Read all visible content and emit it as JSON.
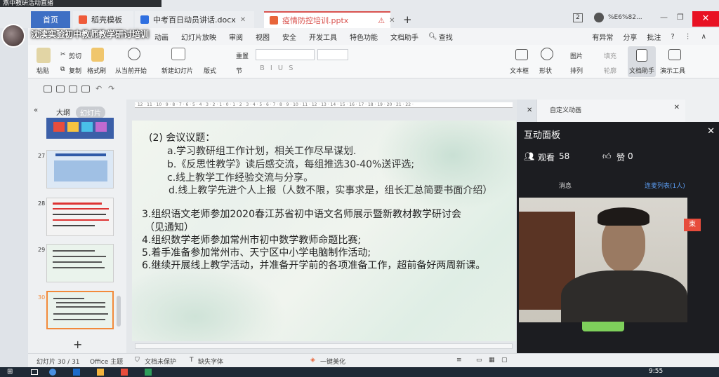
{
  "stream_overlay_title": "燕中教研活动直播",
  "tabs": [
    {
      "label": "首页"
    },
    {
      "label": "稻壳模板"
    },
    {
      "label": "中考百日动员讲话.docx"
    },
    {
      "label": "疫情防控培训.pptx"
    }
  ],
  "tab_new_label": "+",
  "window_badge": "2",
  "window_user_text": "%E6%82...",
  "live_title": "沈渎实验初中教师教学研讨培训",
  "menu": [
    "动画",
    "幻灯片放映",
    "审阅",
    "视图",
    "安全",
    "开发工具",
    "特色功能",
    "文档助手",
    "查找"
  ],
  "menu_right": [
    "有异常",
    "分享",
    "批注"
  ],
  "ribbon": {
    "paste": "粘贴",
    "cut": "剪切",
    "copy": "复制",
    "format_painter": "格式刷",
    "play_from_current": "从当前开始",
    "new_slide": "新建幻灯片",
    "layout": "版式",
    "section": "节",
    "reset": "重置",
    "textbox": "文本框",
    "shape": "形状",
    "arrange": "排列",
    "picture": "图片",
    "fill": "填充",
    "outline": "轮廓",
    "doc_assistant": "文档助手",
    "present_tools": "演示工具"
  },
  "panel_tabs": {
    "outline": "大纲",
    "slides": "幻灯片"
  },
  "thumbnails": [
    {
      "num": "27",
      "bg": "#dce8f5"
    },
    {
      "num": "28",
      "bg": "#f3f3f3"
    },
    {
      "num": "29",
      "bg": "#eaf3ec"
    },
    {
      "num": "30",
      "bg": "#eaf3ec"
    }
  ],
  "add_slide": "+",
  "slide": {
    "heading": "(2) 会议议题：",
    "items": [
      "a.学习教研组工作计划，相关工作尽早谋划.",
      "b.《反思性教学》读后感交流，每组推选30-40%送评选;",
      "c.线上教学工作经验交流与分享。",
      "d.线上教学先进个人上报（人数不限，实事求是，组长汇总简要书面介绍）"
    ],
    "points": [
      "3.组织语文老师参加2020春江苏省初中语文名师展示暨新教材教学研讨会",
      "（见通知）",
      "4.组织数学老师参加常州市初中数学教师命题比赛;",
      "5.着手准备参加常州市、天宁区中小学电脑制作活动;",
      "6.继续开展线上教学活动，并准备开学前的各项准备工作，超前备好两周新课。"
    ]
  },
  "right_pane_title": "自定义动画",
  "status": {
    "slide_count": "幻灯片 30 / 31",
    "theme": "Office 主题",
    "protect": "文档未保护",
    "missing_font": "缺失字体",
    "beautify": "一键美化"
  },
  "overlay": {
    "title": "互动面板",
    "viewers_label": "观看",
    "viewers": "58",
    "likes_label": "赞",
    "likes": "0",
    "tab_messages": "消息",
    "tab_mic_list": "连麦列表(1人)",
    "end_label": "束"
  },
  "taskbar_time": "9:55"
}
